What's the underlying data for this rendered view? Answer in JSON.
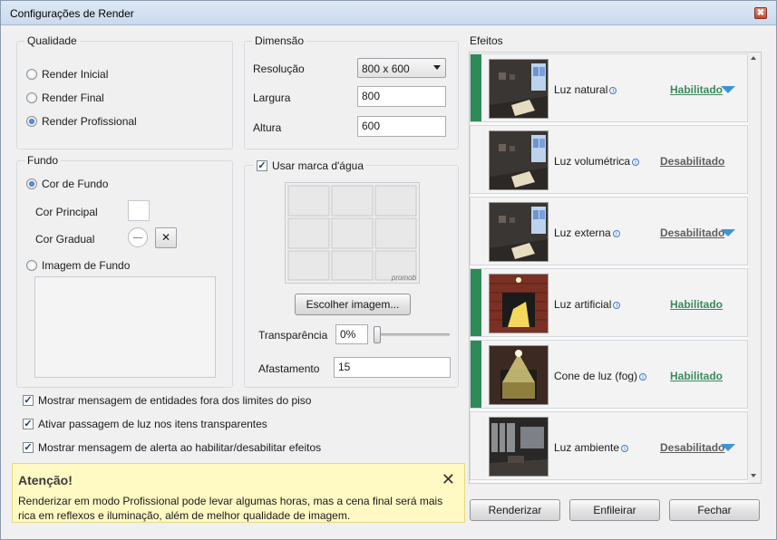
{
  "window": {
    "title": "Configurações de Render",
    "close_glyph": "✖"
  },
  "quality": {
    "legend": "Qualidade",
    "options": [
      {
        "label": "Render Inicial",
        "checked": false
      },
      {
        "label": "Render Final",
        "checked": false
      },
      {
        "label": "Render Profissional",
        "checked": true
      }
    ]
  },
  "dimension": {
    "legend": "Dimensão",
    "resolution_label": "Resolução",
    "resolution_value": "800 x 600",
    "width_label": "Largura",
    "width_value": "800",
    "height_label": "Altura",
    "height_value": "600"
  },
  "background": {
    "legend": "Fundo",
    "bg_color_label": "Cor de Fundo",
    "bg_color_checked": true,
    "primary_color_label": "Cor Principal",
    "gradient_color_label": "Cor Gradual",
    "clear_glyph": "✕",
    "image_label": "Imagem de Fundo",
    "image_checked": false
  },
  "watermark": {
    "checkbox_label": "Usar marca d'água",
    "checked": true,
    "logo_text": "promob",
    "choose_button": "Escolher imagem...",
    "transparency_label": "Transparência",
    "transparency_value": "0%",
    "transparency_level": 0,
    "distance_label": "Afastamento",
    "distance_value": "15"
  },
  "options": [
    {
      "label": "Mostrar mensagem de entidades fora dos limites do piso",
      "checked": true
    },
    {
      "label": "Ativar passagem de luz nos itens transparentes",
      "checked": true
    },
    {
      "label": "Mostrar mensagem de alerta ao habilitar/desabilitar efeitos",
      "checked": true
    }
  ],
  "alert": {
    "title": "Atenção!",
    "close_glyph": "✕",
    "body": "Renderizar em modo Profissional pode levar algumas horas, mas a cena final será mais rica em reflexos e iluminação, além de melhor qualidade de imagem."
  },
  "effects": {
    "title": "Efeitos",
    "info_glyph": "i",
    "enabled_color": "#2e8b57",
    "items": [
      {
        "name": "Luz natural",
        "status": "Habilitado",
        "enabled": true,
        "has_menu": true,
        "thumb": "room-dim"
      },
      {
        "name": "Luz volumétrica",
        "status": "Desabilitado",
        "enabled": false,
        "has_menu": false,
        "thumb": "room-dim"
      },
      {
        "name": "Luz externa",
        "status": "Desabilitado",
        "enabled": false,
        "has_menu": true,
        "thumb": "room-dim"
      },
      {
        "name": "Luz artificial",
        "status": "Habilitado",
        "enabled": true,
        "has_menu": false,
        "thumb": "lamp-brick"
      },
      {
        "name": "Cone de luz (fog)",
        "status": "Habilitado",
        "enabled": true,
        "has_menu": false,
        "thumb": "lamp-cone"
      },
      {
        "name": "Luz ambiente",
        "status": "Desabilitado",
        "enabled": false,
        "has_menu": true,
        "thumb": "room-windows"
      }
    ]
  },
  "footer": {
    "render_button": "Renderizar",
    "queue_button": "Enfileirar",
    "close_button": "Fechar"
  }
}
